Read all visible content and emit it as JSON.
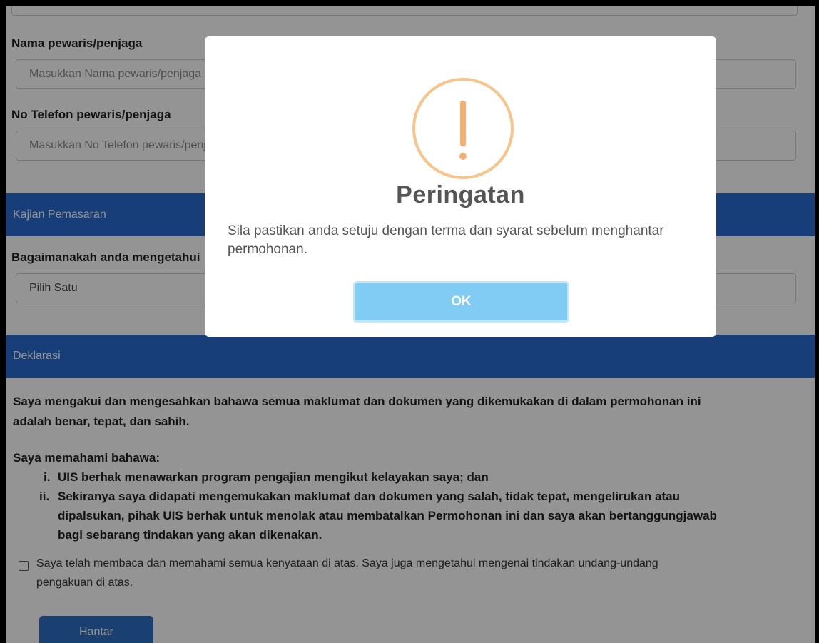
{
  "form": {
    "guardian_name_label": "Nama pewaris/penjaga",
    "guardian_name_placeholder": "Masukkan Nama pewaris/penjaga",
    "guardian_phone_label": "No Telefon pewaris/penjaga",
    "guardian_phone_placeholder": "Masukkan No Telefon pewaris/penjaga",
    "marketing_section": "Kajian Pemasaran",
    "marketing_question": "Bagaimanakah anda mengetahui",
    "marketing_select_value": "Pilih Satu",
    "declaration_section": "Deklarasi",
    "declaration_line1": "Saya mengakui dan mengesahkan bahawa semua maklumat dan dokumen yang dikemukakan di dalam permohonan ini",
    "declaration_line2": "adalah benar, tepat, dan sahih.",
    "understand_heading": "Saya memahami bahawa:",
    "item1_marker": "i.",
    "item1": "UIS berhak menawarkan program pengajian mengikut kelayakan saya; dan",
    "item2_marker": "ii.",
    "item2_line1": "Sekiranya saya didapati mengemukakan maklumat dan dokumen yang salah, tidak tepat, mengelirukan atau",
    "item2_line2": "dipalsukan, pihak UIS berhak untuk menolak atau membatalkan Permohonan ini dan saya akan bertanggungjawab",
    "item2_line3": "bagi sebarang tindakan yang akan dikenakan.",
    "ack_line1": "Saya telah membaca dan memahami semua kenyataan di atas. Saya juga mengetahui mengenai tindakan undang-undang",
    "ack_line2": "pengakuan di atas.",
    "submit_label": "Hantar"
  },
  "modal": {
    "title": "Peringatan",
    "message": "Sila pastikan anda setuju dengan terma dan syarat sebelum menghantar permohonan.",
    "ok_label": "OK",
    "icon": "warning-icon"
  },
  "colors": {
    "section_bar": "#2a6bd0",
    "submit_button": "#2e6fc4",
    "ok_button": "#80ccf5",
    "warning_icon": "#f8c48a"
  }
}
